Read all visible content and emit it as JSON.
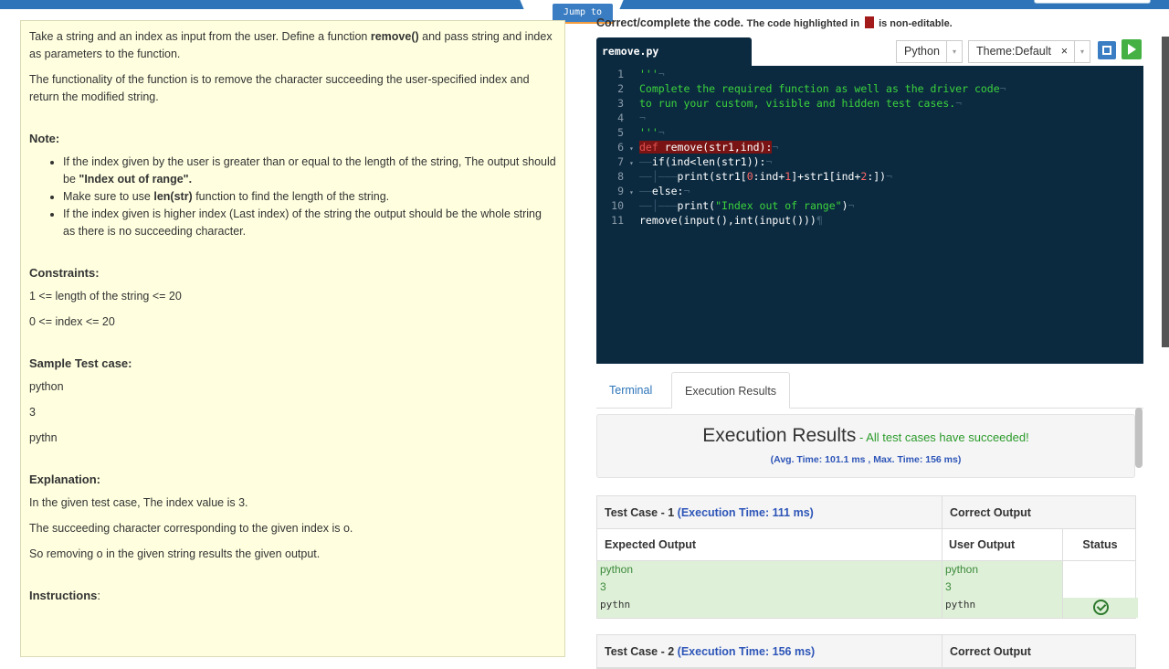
{
  "topbar": {
    "jump_label": "Jump to"
  },
  "problem": {
    "p1_a": "Take a string and an index as input from the user. Define a function ",
    "p1_b": "remove()",
    "p1_c": " and pass string and index as parameters to the function.",
    "p2": "The functionality of the function is to remove the character succeeding the user-specified index and return the modified string.",
    "note_heading": "Note:",
    "note1_a": "If the index given by the user is greater than or equal to the length of the string, The output should be ",
    "note1_b": "\"Index out of range\".",
    "note2_a": "Make sure to use ",
    "note2_b": "len(str)",
    "note2_c": " function to find the length of the string.",
    "note3": "If the index given is higher index (Last index) of the string the output should be the whole string as there is no succeeding character.",
    "constraints_heading": "Constraints:",
    "constraint1": "1 <= length of the string <= 20",
    "constraint2": "0 <= index <= 20",
    "sample_heading": "Sample Test case:",
    "sample_lines": [
      "python",
      "3",
      "pythn"
    ],
    "explanation_heading": "Explanation:",
    "explanation_lines": [
      "In the given test case, The index value is 3.",
      "The succeeding character corresponding to the given index is o.",
      "So removing o in the given string results the given output."
    ],
    "instructions_heading": "Instructions",
    "instructions_colon": ":"
  },
  "editor": {
    "title_bold": "Correct/complete the code.",
    "title_small_a": "The code highlighted in",
    "title_small_b": "is non-editable.",
    "filename": "remove.py",
    "language": "Python",
    "theme": "Theme:Default",
    "theme_clear": "×",
    "dropdown_arrow": "▾",
    "lines": [
      "1",
      "2",
      "3",
      "4",
      "5",
      "6",
      "7",
      "8",
      "9",
      "10",
      "11"
    ],
    "code": {
      "l1": "'''",
      "l2": "Complete the required function as well as the driver code",
      "l3": "to run your custom, visible and hidden test cases.",
      "l5": "'''",
      "l6_kw": "def",
      "l6_rest": " remove(str1,ind):",
      "l7": "if(ind<len(str1)):",
      "l8_a": "print(str1[",
      "l8_n1": "0",
      "l8_b": ":ind+",
      "l8_n2": "1",
      "l8_c": "]+str1[ind+",
      "l8_n3": "2",
      "l8_d": ":])",
      "l9": "else:",
      "l10_a": "print(",
      "l10_s": "\"Index out of range\"",
      "l10_b": ")",
      "l11": "remove(input(),int(input()))"
    }
  },
  "tabs": {
    "terminal": "Terminal",
    "execution": "Execution Results"
  },
  "results": {
    "title": "Execution Results",
    "status": " - All test cases have succeeded!",
    "avg": "(Avg. Time: 101.1 ms , Max. Time: 156 ms)"
  },
  "test_cases": [
    {
      "label": "Test Case - 1 ",
      "time": "(Execution Time: 111 ms)",
      "correct": "Correct Output",
      "expected_header": "Expected Output",
      "user_header": "User Output",
      "status_header": "Status",
      "expected": [
        "python",
        "3",
        "pythn"
      ],
      "user": [
        "python",
        "3",
        "pythn"
      ],
      "status": "passed"
    },
    {
      "label": "Test Case - 2 ",
      "time": "(Execution Time: 156 ms)",
      "correct": "Correct Output"
    }
  ]
}
